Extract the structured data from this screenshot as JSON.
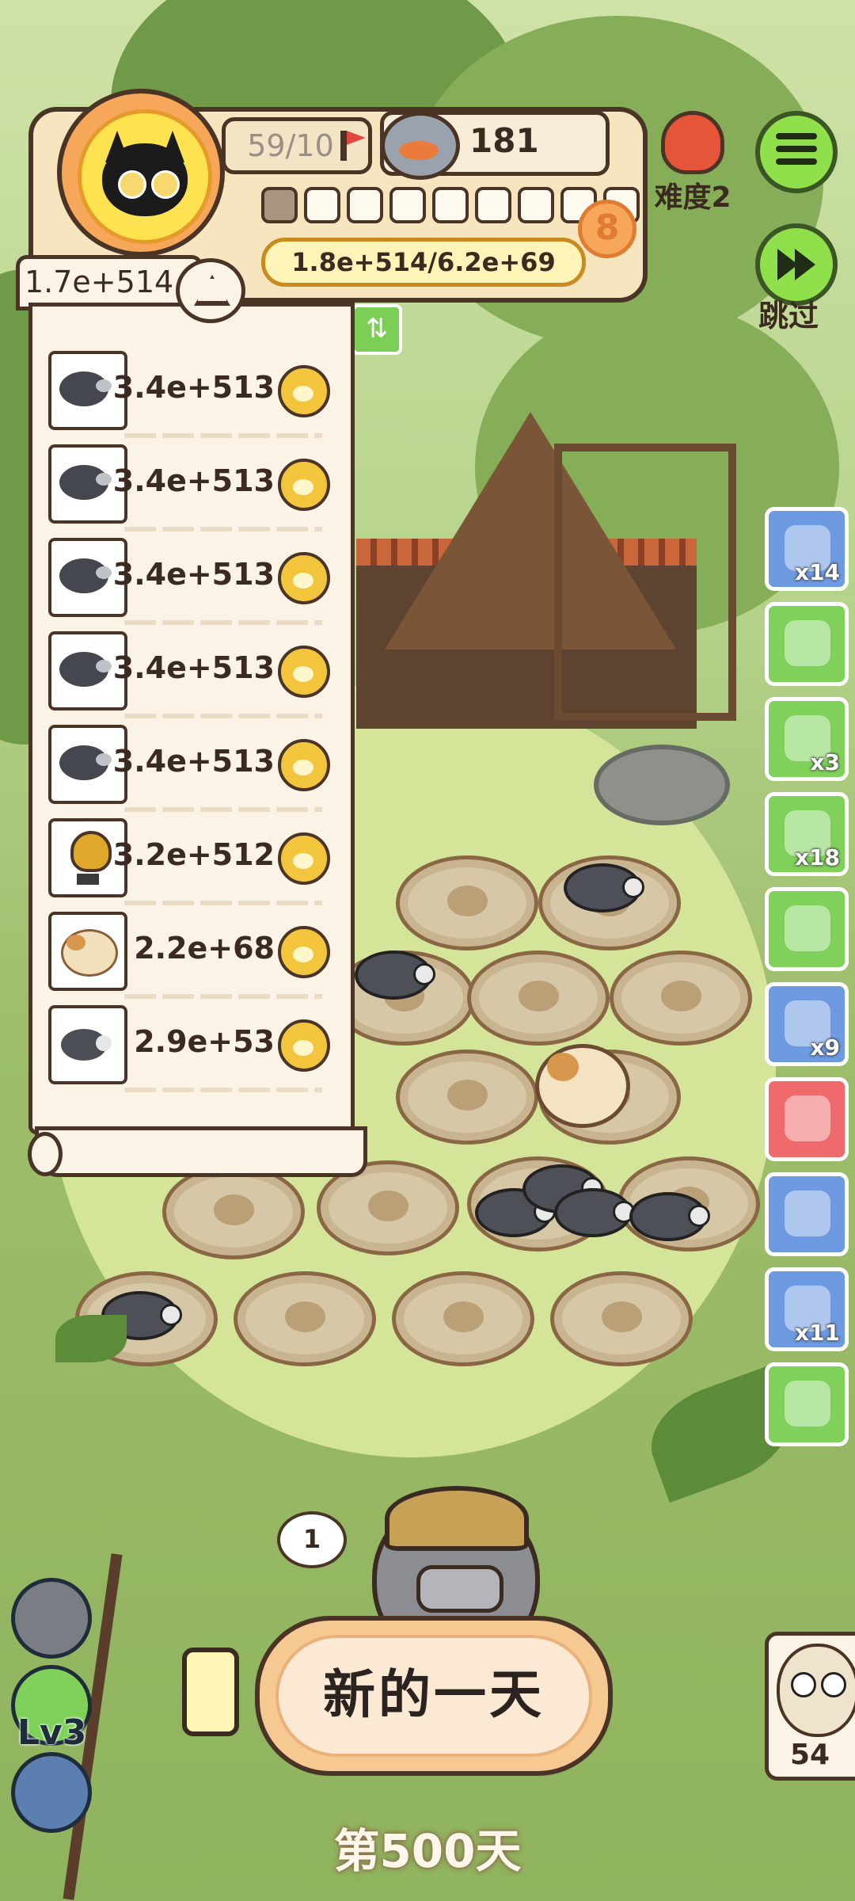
{
  "header": {
    "flag_count": "59/10",
    "food_count": "181",
    "level": "8",
    "progress_filled": 1,
    "progress_total": 9,
    "exp_text": "1.8e+514/6.2e+69"
  },
  "difficulty": {
    "label": "难度2"
  },
  "skip": {
    "label": "跳过"
  },
  "resources": {
    "total": "1.7e+514",
    "items": [
      {
        "icon": "mole",
        "value": "3.4e+513"
      },
      {
        "icon": "mole",
        "value": "3.4e+513"
      },
      {
        "icon": "mole",
        "value": "3.4e+513"
      },
      {
        "icon": "mole",
        "value": "3.4e+513"
      },
      {
        "icon": "mole",
        "value": "3.4e+513"
      },
      {
        "icon": "trophy",
        "value": "3.2e+512"
      },
      {
        "icon": "hamster",
        "value": "2.2e+68"
      },
      {
        "icon": "rat",
        "value": "2.9e+53"
      }
    ]
  },
  "side_items": [
    {
      "icon": "radio-icon",
      "color": "#6d9ae0",
      "count": "x14"
    },
    {
      "icon": "ticket-icon",
      "color": "#7fd15a",
      "count": ""
    },
    {
      "icon": "coupon-icon",
      "color": "#7fd15a",
      "count": "x3"
    },
    {
      "icon": "worm-icon",
      "color": "#7fd15a",
      "count": "x18"
    },
    {
      "icon": "cancel-ticket-icon",
      "color": "#7fd15a",
      "count": ""
    },
    {
      "icon": "sack-icon",
      "color": "#6d9ae0",
      "count": "x9"
    },
    {
      "icon": "bird-icon",
      "color": "#ef6b6b",
      "count": ""
    },
    {
      "icon": "trophy-icon",
      "color": "#6d9ae0",
      "count": ""
    },
    {
      "icon": "glove-icon",
      "color": "#6d9ae0",
      "count": "x11"
    },
    {
      "icon": "card-icon",
      "color": "#7fd15a",
      "count": ""
    }
  ],
  "bottom": {
    "bubble_count": "1",
    "new_day_label": "新的一天",
    "day_counter": "第500天",
    "left_level": "Lv3",
    "owl_count": "54"
  }
}
